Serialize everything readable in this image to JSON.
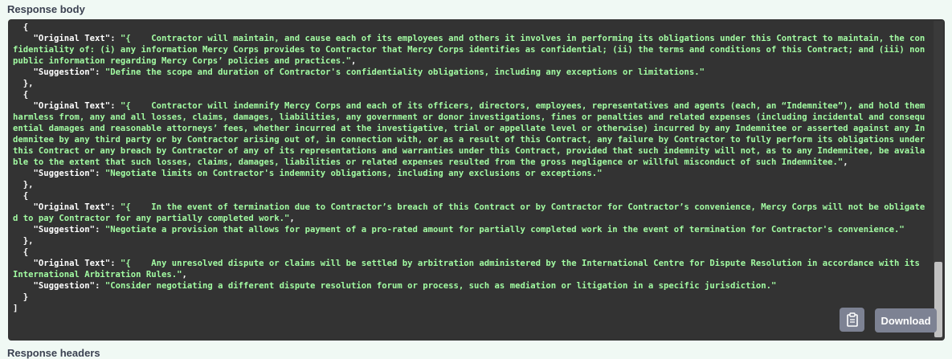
{
  "header": {
    "title": "Response body"
  },
  "footer": {
    "title": "Response headers"
  },
  "response": {
    "open_bracket": "[",
    "close_bracket": "]",
    "items": [
      {
        "original_key": "\"Original Text\"",
        "original_value": "\"{    Contractor will maintain, and cause each of its employees and others it involves in performing its obligations under this Contract to maintain, the confidentiality of: (i) any information Mercy Corps provides to Contractor that Mercy Corps identifies as confidential; (ii) the terms and conditions of this Contract; and (iii) nonpublic information regarding Mercy Corps’ policies and practices.\"",
        "suggestion_key": "\"Suggestion\"",
        "suggestion_value": "\"Define the scope and duration of Contractor's confidentiality obligations, including any exceptions or limitations.\""
      },
      {
        "original_key": "\"Original Text\"",
        "original_value": "\"{    Contractor will indemnify Mercy Corps and each of its officers, directors, employees, representatives and agents (each, an “Indemnitee”), and hold them harmless from, any and all losses, claims, damages, liabilities, any government or donor investigations, fines or penalties and related expenses (including incidental and consequential damages and reasonable attorneys’ fees, whether incurred at the investigative, trial or appellate level or otherwise) incurred by any Indemnitee or asserted against any Indemnitee by any third party or by Contractor arising out of, in connection with, or as a result of this Contract, any failure by Contractor to fully perform its obligations under this Contract or any breach by Contractor of any of its representations and warranties under this Contract, provided that such indemnity will not, as to any Indemnitee, be available to the extent that such losses, claims, damages, liabilities or related expenses resulted from the gross negligence or willful misconduct of such Indemnitee.\"",
        "suggestion_key": "\"Suggestion\"",
        "suggestion_value": "\"Negotiate limits on Contractor's indemnity obligations, including any exclusions or exceptions.\""
      },
      {
        "original_key": "\"Original Text\"",
        "original_value": "\"{    In the event of termination due to Contractor’s breach of this Contract or by Contractor for Contractor’s convenience, Mercy Corps will not be obligated to pay Contractor for any partially completed work.\"",
        "suggestion_key": "\"Suggestion\"",
        "suggestion_value": "\"Negotiate a provision that allows for payment of a pro-rated amount for partially completed work in the event of termination for Contractor's convenience.\""
      },
      {
        "original_key": "\"Original Text\"",
        "original_value": "\"{    Any unresolved dispute or claims will be settled by arbitration administered by the International Centre for Dispute Resolution in accordance with its International Arbitration Rules.\"",
        "suggestion_key": "\"Suggestion\"",
        "suggestion_value": "\"Consider negotiating a different dispute resolution forum or process, such as mediation or litigation in a specific jurisdiction.\""
      }
    ]
  },
  "buttons": {
    "copy_icon": "clipboard-icon",
    "download_label": "Download"
  },
  "colors": {
    "code_background": "#333333",
    "string_color": "#a2fca2",
    "button_background": "#7d8293",
    "page_background": "#f0f9f4"
  }
}
